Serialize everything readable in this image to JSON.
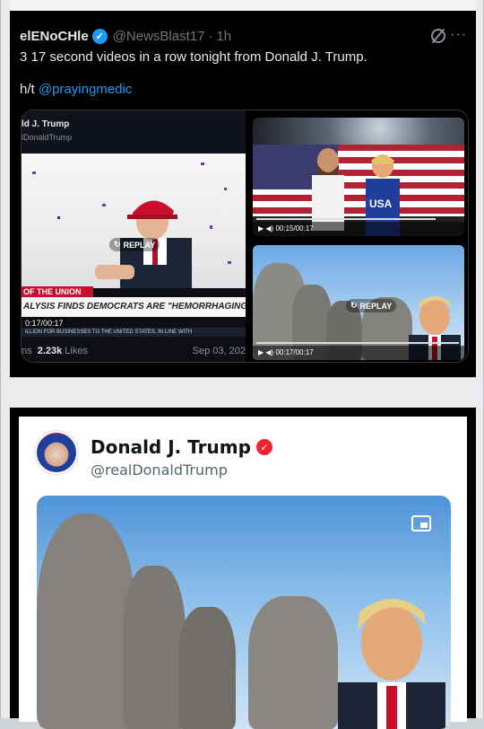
{
  "tweet": {
    "display_name": "elENoCHle",
    "handle": "@NewsBlast17",
    "separator": "·",
    "time": "1h",
    "text_line1": "3 17 second videos in a row tonight from Donald J. Trump.",
    "hat_tip": "h/t",
    "mention": "@prayingmedic",
    "more_glyph": "···"
  },
  "left_video": {
    "account_name": "ld J. Trump",
    "account_handle": "lDonaldTrump",
    "hat_text": "AMERICA GREAT AGAIN",
    "replay_label": "REPLAY",
    "lower_third_tag": "OF THE UNION",
    "lower_third_headline": "ALYSIS FINDS DEMOCRATS ARE \"HEMORRHAGING\" VOTERS",
    "timestamp": "0:17/00:17",
    "ticker": "ILLION FOR BUSINESSES TO THE UNITED STATES, IN LINE WITH",
    "likes_prefix": "ns",
    "likes_count": "2.23k",
    "likes_label": "Likes",
    "date": "Sep 03, 202"
  },
  "right_top_video": {
    "shirt_text": "USA",
    "timestamp": "00:15/00:17"
  },
  "right_bottom_video": {
    "replay_label": "REPLAY",
    "timestamp": "00:17/00:17"
  },
  "post2": {
    "display_name": "Donald J. Trump",
    "handle": "@realDonaldTrump"
  },
  "colors": {
    "x_blue": "#1d9bf0",
    "truth_red": "#f4212e",
    "flag_red": "#b22234",
    "flag_blue": "#3c3b6e"
  }
}
